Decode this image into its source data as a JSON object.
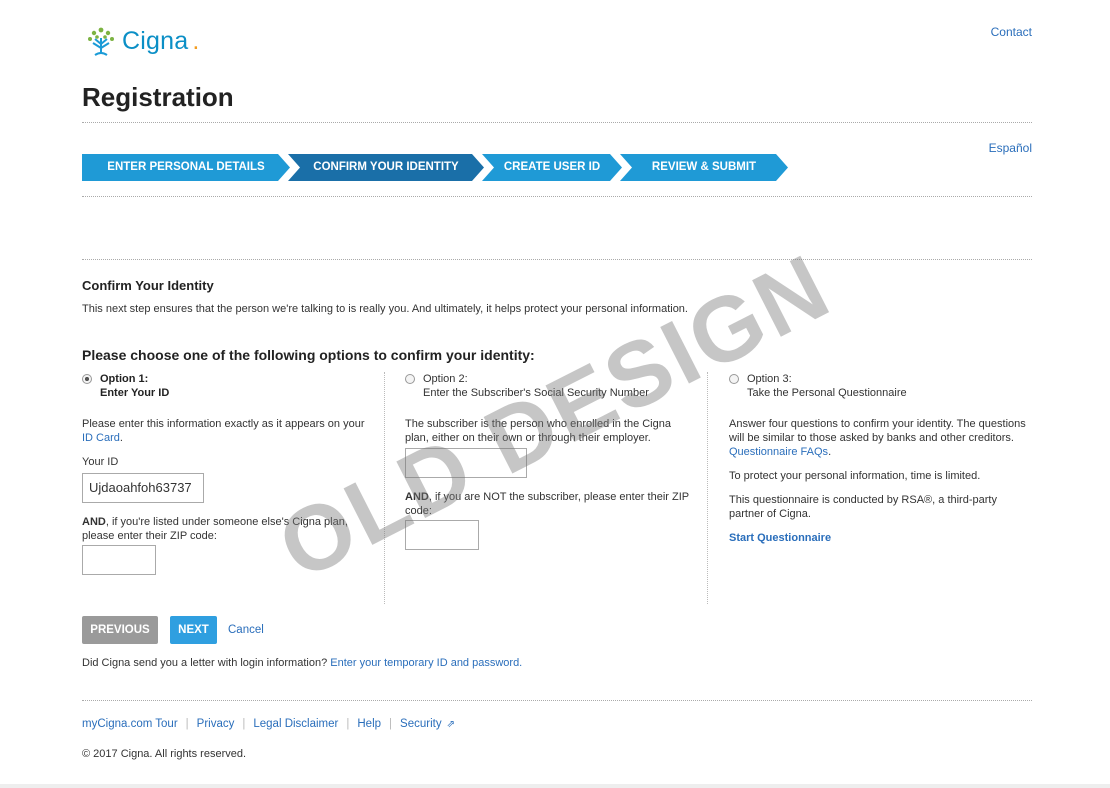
{
  "header": {
    "logo_text": "Cigna",
    "contact_link": "Contact",
    "page_title": "Registration",
    "language_link": "Español"
  },
  "steps": [
    {
      "label": "ENTER PERSONAL DETAILS",
      "active": false
    },
    {
      "label": "CONFIRM YOUR IDENTITY",
      "active": true
    },
    {
      "label": "CREATE USER ID",
      "active": false
    },
    {
      "label": "REVIEW & SUBMIT",
      "active": false
    }
  ],
  "section": {
    "title": "Confirm Your Identity",
    "description": "This next step ensures that the person we're talking to is really you. And ultimately, it helps protect your personal information.",
    "choose_prompt": "Please choose one of the following options to confirm your identity:"
  },
  "option1": {
    "label_line1": "Option 1:",
    "label_line2": "Enter Your ID",
    "selected": true,
    "instruction": "Please enter this information exactly as it appears on your",
    "instruction_link": "ID Card",
    "instruction_end": ".",
    "id_label": "Your ID",
    "id_value": "Ujdaoahfoh63737",
    "and_bold": "AND",
    "and_text": ", if you're listed under someone else's Cigna plan, please enter their ZIP code:",
    "zip_value": ""
  },
  "option2": {
    "label_line1": "Option 2:",
    "label_line2": "Enter the Subscriber's Social Security Number",
    "selected": false,
    "instruction": "The subscriber is the person who enrolled in the Cigna plan, either on their own or through their employer.",
    "ssn_value": "",
    "and_bold": "AND",
    "and_text": ", if you are NOT the subscriber, please enter their ZIP code:",
    "zip_value": ""
  },
  "option3": {
    "label_line1": "Option 3:",
    "label_line2": "Take the Personal Questionnaire",
    "selected": false,
    "para1": "Answer four questions to confirm your identity. The questions will be similar to those asked by banks and other creditors.",
    "faq_link": "Questionnaire FAQs",
    "faq_end": ".",
    "para2": "To protect your personal information, time is limited.",
    "para3": "This questionnaire is conducted by RSA®, a third-party partner of Cigna.",
    "start_link": "Start Questionnaire"
  },
  "actions": {
    "previous": "PREVIOUS",
    "next": "NEXT",
    "cancel": "Cancel"
  },
  "letter": {
    "text": "Did Cigna send you a letter with login information?",
    "link": "Enter your temporary ID and password."
  },
  "footer": {
    "links": [
      "myCigna.com Tour",
      "Privacy",
      "Legal Disclaimer",
      "Help",
      "Security"
    ],
    "copyright": "© 2017 Cigna. All rights reserved."
  },
  "watermark": "OLD DESIGN",
  "colors": {
    "step_blue": "#1f9ad6",
    "step_active": "#1a6fa8",
    "link": "#2a6ebb",
    "brand_teal": "#0b8fc6",
    "button_next": "#2f9fe0",
    "button_prev": "#9a9a9a"
  }
}
